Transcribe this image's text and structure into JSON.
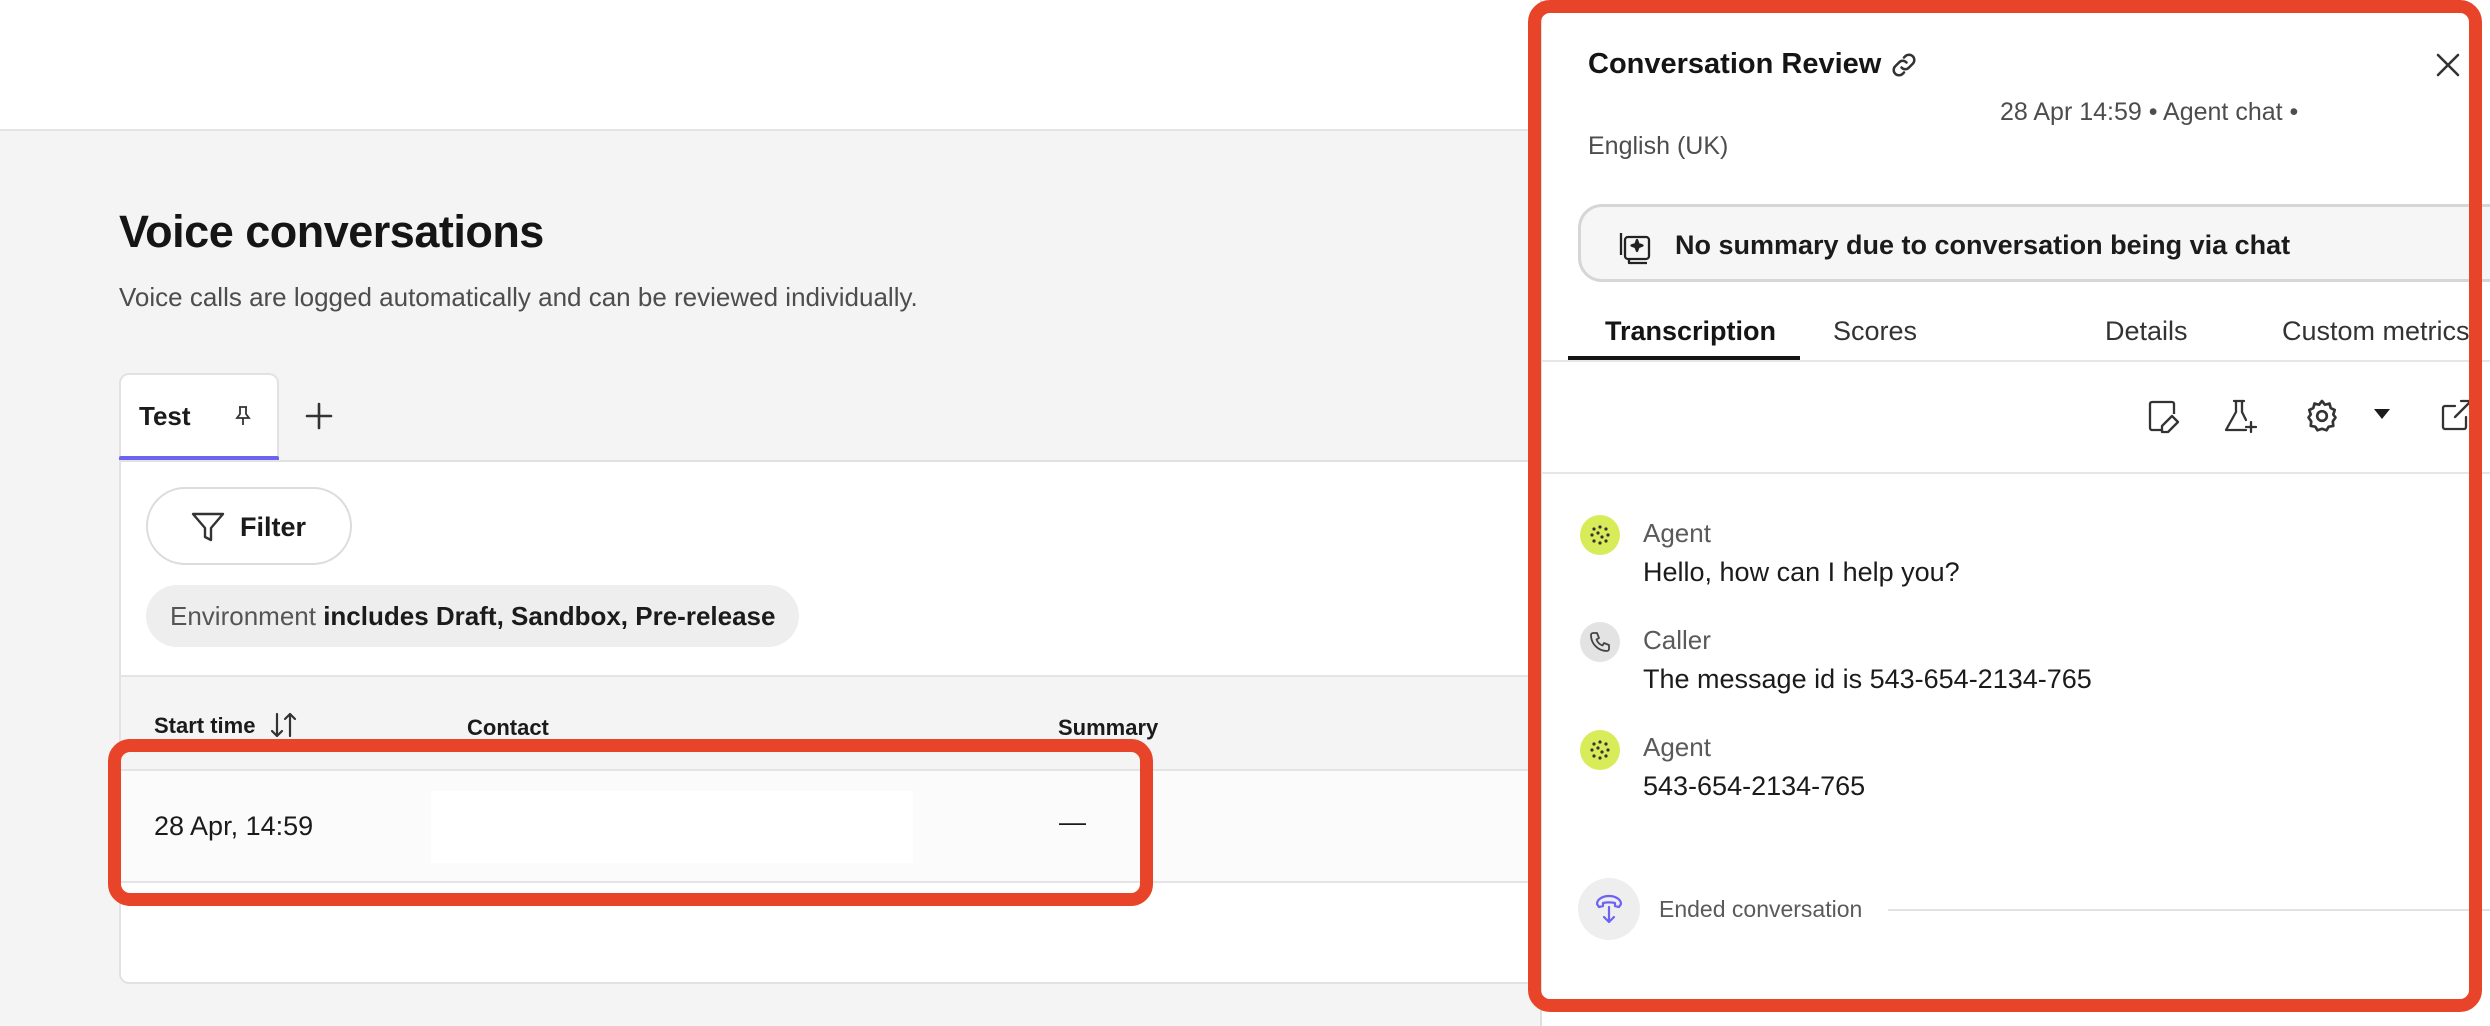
{
  "page": {
    "title": "Voice conversations",
    "subtitle": "Voice calls are logged automatically and can be reviewed individually.",
    "tabs": [
      {
        "label": "Test",
        "active": true,
        "pinned": true
      }
    ],
    "add_tab_icon": "plus-icon"
  },
  "filters": {
    "filter_label": "Filter",
    "environment_prefix": "Environment",
    "environment_value": "includes Draft, Sandbox, Pre-release"
  },
  "table": {
    "columns": [
      "Start time",
      "Contact",
      "Summary"
    ],
    "rows": [
      {
        "start_time": "28 Apr, 14:59",
        "contact": "",
        "summary": "—"
      }
    ]
  },
  "panel": {
    "title": "Conversation Review",
    "meta_line1": "28 Apr 14:59 • Agent chat •",
    "meta_line2": "English (UK)",
    "summary_text": "No summary due to conversation being via chat",
    "tabs": [
      "Transcription",
      "Scores",
      "Details",
      "Custom metrics"
    ],
    "active_tab": "Transcription",
    "messages": [
      {
        "role": "Agent",
        "text": "Hello, how can I help you?"
      },
      {
        "role": "Caller",
        "text": "The message id is 543-654-2134-765"
      },
      {
        "role": "Agent",
        "text": "543-654-2134-765"
      }
    ],
    "ended_label": "Ended conversation"
  },
  "colors": {
    "accent": "#6c63f2",
    "highlight": "#e8442a",
    "agent_avatar": "#d8ec5a"
  }
}
